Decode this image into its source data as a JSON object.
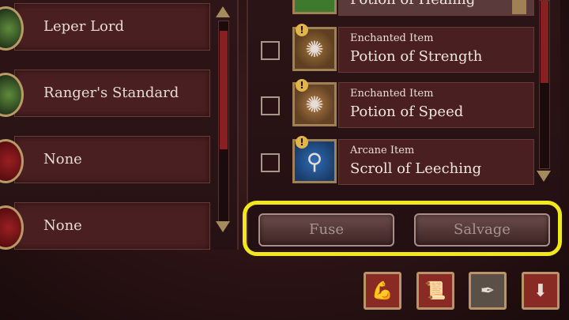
{
  "left_panel": {
    "slots": [
      {
        "label": "Leper Lord",
        "medallion": "green"
      },
      {
        "label": "Ranger's Standard",
        "medallion": "green"
      },
      {
        "label": "None",
        "medallion": "red"
      },
      {
        "label": "None",
        "medallion": "red"
      }
    ]
  },
  "right_panel": {
    "partial_item_name": "Potion of Healing",
    "items": [
      {
        "type": "Enchanted Item",
        "name": "Potion of Strength",
        "icon": "strength-potion-icon"
      },
      {
        "type": "Enchanted Item",
        "name": "Potion of Speed",
        "icon": "speed-potion-icon"
      },
      {
        "type": "Arcane Item",
        "name": "Scroll of Leeching",
        "icon": "scroll-icon"
      }
    ],
    "badge_symbol": "!"
  },
  "actions": {
    "fuse_label": "Fuse",
    "salvage_label": "Salvage"
  },
  "toolbar": [
    {
      "icon": "strength-arm-icon"
    },
    {
      "icon": "scroll-page-icon"
    },
    {
      "icon": "feather-icon"
    },
    {
      "icon": "download-icon"
    }
  ],
  "colors": {
    "highlight": "#f2e81c",
    "panel": "#4a1f21",
    "background": "#2a1214"
  }
}
